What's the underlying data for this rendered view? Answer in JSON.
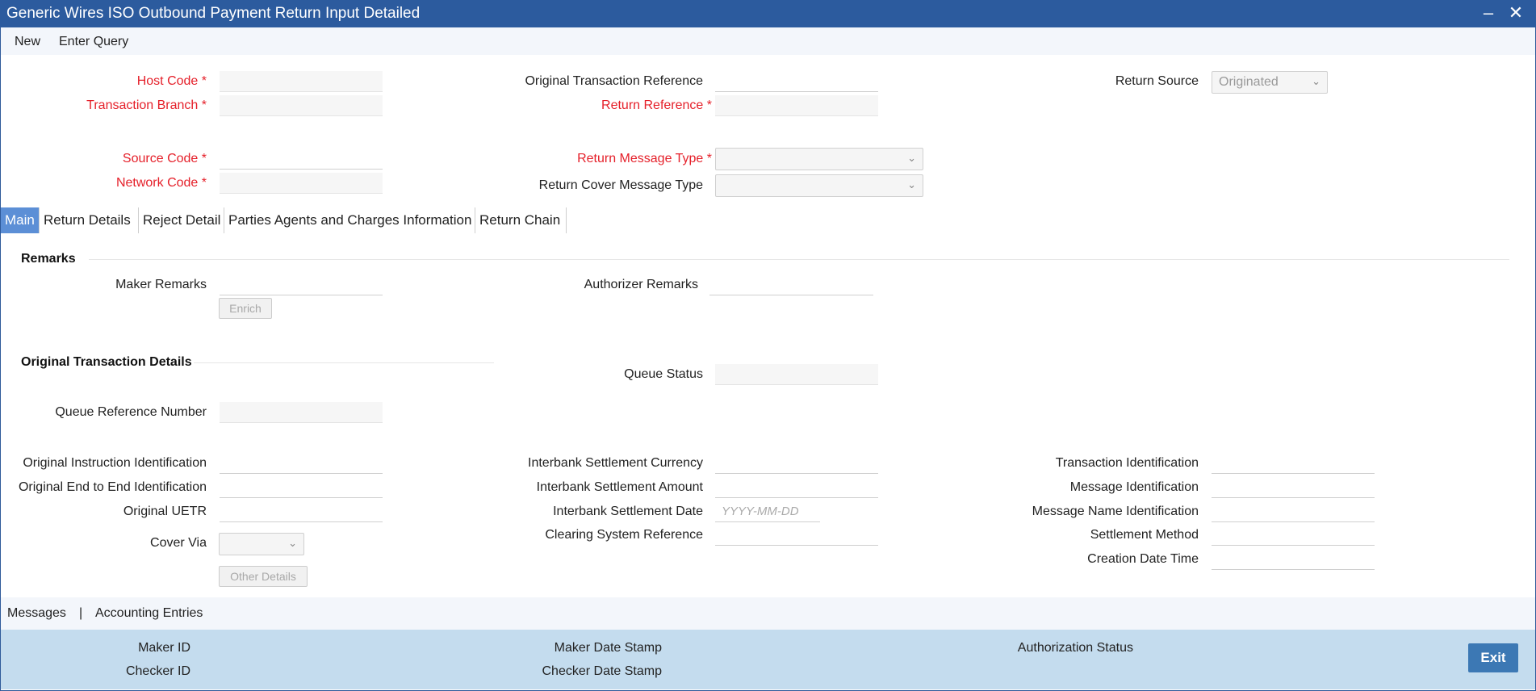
{
  "window": {
    "title": "Generic Wires ISO Outbound Payment Return Input Detailed",
    "minimize": "‒",
    "close": "✕"
  },
  "toolbar": {
    "new": "New",
    "enter_query": "Enter Query"
  },
  "header": {
    "host_code": "Host Code",
    "transaction_branch": "Transaction Branch",
    "source_code": "Source Code",
    "network_code": "Network Code",
    "original_transaction_reference": "Original Transaction Reference",
    "return_reference": "Return Reference",
    "return_message_type": "Return Message Type",
    "return_cover_message_type": "Return Cover Message Type",
    "return_source": "Return Source",
    "return_source_value": "Originated",
    "required_mark": "*"
  },
  "tabs": [
    "Main",
    "Return Details",
    "Reject Detail",
    "Parties Agents and Charges Information",
    "Return Chain"
  ],
  "remarks": {
    "title": "Remarks",
    "maker_remarks": "Maker Remarks",
    "authorizer_remarks": "Authorizer Remarks",
    "enrich": "Enrich"
  },
  "original": {
    "title": "Original Transaction Details",
    "queue_status": "Queue Status",
    "queue_reference_number": "Queue Reference Number",
    "original_instruction_identification": "Original Instruction Identification",
    "original_end_to_end_identification": "Original End to End Identification",
    "original_uetr": "Original UETR",
    "cover_via": "Cover Via",
    "other_details": "Other Details",
    "interbank_settlement_currency": "Interbank Settlement Currency",
    "interbank_settlement_amount": "Interbank Settlement Amount",
    "interbank_settlement_date": "Interbank Settlement Date",
    "date_placeholder": "YYYY-MM-DD",
    "clearing_system_reference": "Clearing System Reference",
    "transaction_identification": "Transaction Identification",
    "message_identification": "Message Identification",
    "message_name_identification": "Message Name Identification",
    "settlement_method": "Settlement Method",
    "creation_date_time": "Creation Date Time"
  },
  "bottom_links": {
    "messages": "Messages",
    "separator": "|",
    "accounting_entries": "Accounting Entries"
  },
  "footer": {
    "maker_id": "Maker ID",
    "checker_id": "Checker ID",
    "maker_date_stamp": "Maker Date Stamp",
    "checker_date_stamp": "Checker Date Stamp",
    "authorization_status": "Authorization Status",
    "exit": "Exit"
  }
}
